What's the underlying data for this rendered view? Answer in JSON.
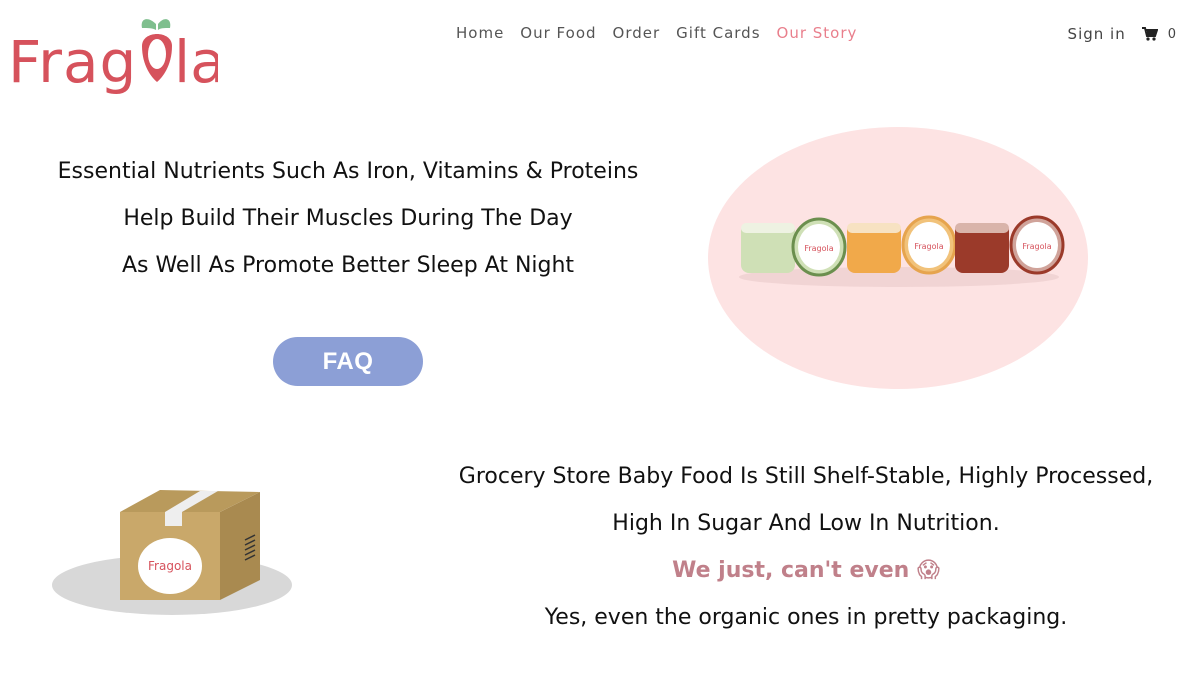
{
  "brand": {
    "name": "Fragola",
    "color": "#d6525c"
  },
  "nav": {
    "items": [
      {
        "label": "Home",
        "active": false
      },
      {
        "label": "Our Food",
        "active": false
      },
      {
        "label": "Order",
        "active": false
      },
      {
        "label": "Gift Cards",
        "active": false
      },
      {
        "label": "Our Story",
        "active": true
      }
    ],
    "active_color": "#e97f8c"
  },
  "account": {
    "sign_in": "Sign in",
    "cart_count": "0"
  },
  "hero": {
    "lines": [
      "Essential Nutrients Such As Iron, Vitamins & Proteins",
      "Help Build Their Muscles During The Day",
      "As Well As Promote Better Sleep At Night"
    ],
    "faq_label": "FAQ"
  },
  "jars_image": {
    "label": "Fragola"
  },
  "box_image": {
    "label": "Fragola"
  },
  "story": {
    "line1": "Grocery Store Baby Food Is Still Shelf-Stable, Highly Processed,",
    "line2": "High In Sugar And Low In Nutrition.",
    "highlight": "We just, can't even 😱",
    "line3": "Yes, even the organic ones in pretty packaging."
  }
}
